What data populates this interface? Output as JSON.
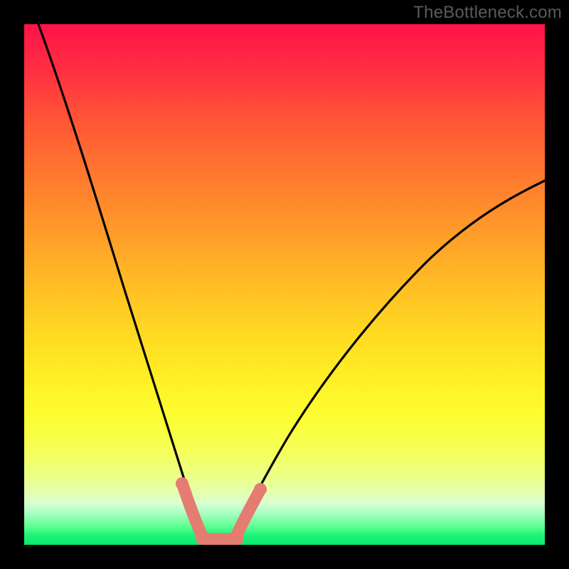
{
  "watermark": "TheBottleneck.com",
  "chart_data": {
    "type": "line",
    "title": "",
    "xlabel": "",
    "ylabel": "",
    "xlim": [
      0,
      1
    ],
    "ylim": [
      0,
      1
    ],
    "background_gradient": {
      "direction": "vertical",
      "stops": [
        {
          "pos": 0.0,
          "color": "#ff1348"
        },
        {
          "pos": 0.5,
          "color": "#ffc324"
        },
        {
          "pos": 0.8,
          "color": "#f4ff58"
        },
        {
          "pos": 1.0,
          "color": "#07e86f"
        }
      ]
    },
    "series": [
      {
        "name": "left-curve",
        "color": "#000000",
        "x": [
          0.03,
          0.12,
          0.2,
          0.26,
          0.3,
          0.33,
          0.345
        ],
        "y": [
          1.0,
          0.75,
          0.5,
          0.28,
          0.12,
          0.04,
          0.0
        ]
      },
      {
        "name": "right-curve",
        "color": "#000000",
        "x": [
          0.4,
          0.45,
          0.52,
          0.62,
          0.74,
          0.88,
          1.0
        ],
        "y": [
          0.0,
          0.06,
          0.18,
          0.35,
          0.5,
          0.62,
          0.7
        ]
      }
    ],
    "marker_overlay": {
      "color": "#e57c71",
      "left_segment": {
        "x": [
          0.305,
          0.345
        ],
        "y": [
          0.105,
          0.0
        ]
      },
      "right_segment": {
        "x": [
          0.41,
          0.45
        ],
        "y": [
          0.015,
          0.068
        ]
      },
      "bottom_bar": {
        "x": [
          0.335,
          0.415
        ],
        "y": [
          0.0,
          0.0
        ]
      }
    }
  }
}
